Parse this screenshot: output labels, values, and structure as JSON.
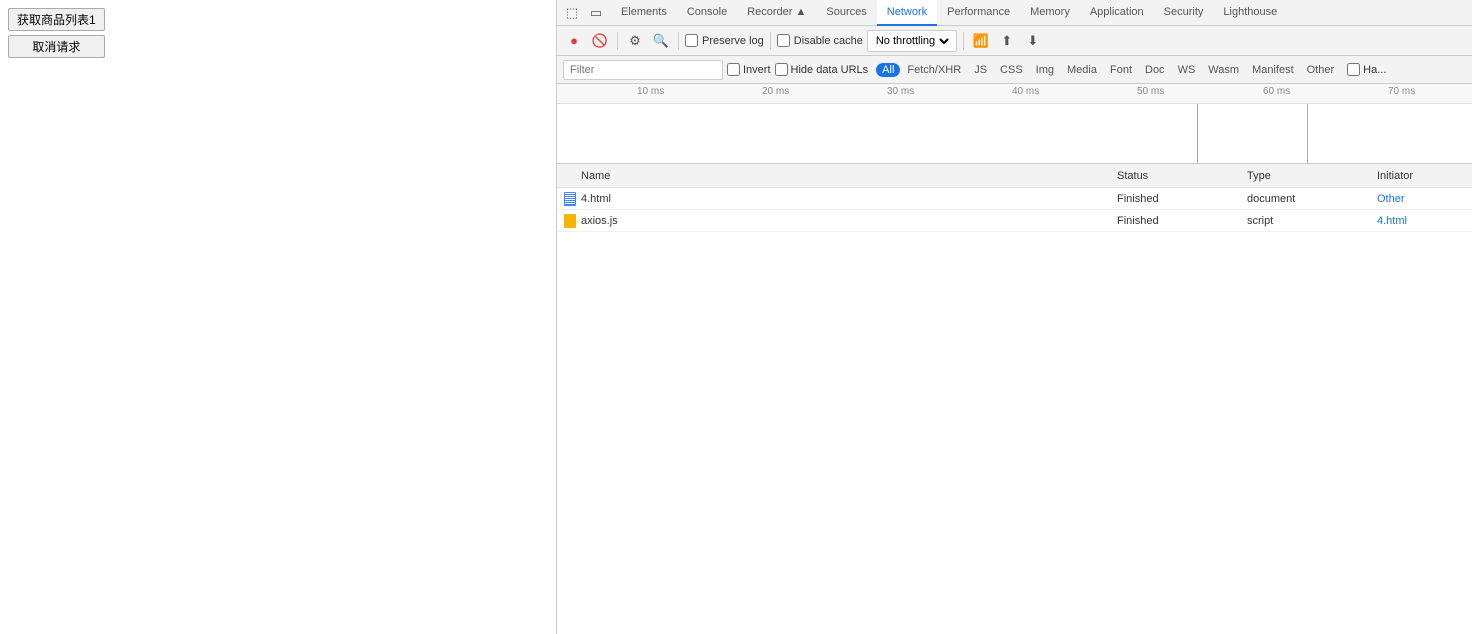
{
  "page": {
    "buttons": [
      {
        "label": "获取商品列表1",
        "type": "primary"
      },
      {
        "label": "取消请求",
        "type": "default"
      }
    ]
  },
  "devtools": {
    "tabs": [
      {
        "label": "Elements",
        "active": false
      },
      {
        "label": "Console",
        "active": false
      },
      {
        "label": "Recorder ▲",
        "active": false
      },
      {
        "label": "Sources",
        "active": false
      },
      {
        "label": "Network",
        "active": true
      },
      {
        "label": "Performance",
        "active": false
      },
      {
        "label": "Memory",
        "active": false
      },
      {
        "label": "Application",
        "active": false
      },
      {
        "label": "Security",
        "active": false
      },
      {
        "label": "Lighthouse",
        "active": false
      }
    ],
    "toolbar": {
      "preserve_log_label": "Preserve log",
      "disable_cache_label": "Disable cache",
      "throttle_label": "No throttling"
    },
    "filter": {
      "placeholder": "Filter",
      "invert_label": "Invert",
      "hide_data_urls_label": "Hide data URLs",
      "type_buttons": [
        "All",
        "Fetch/XHR",
        "JS",
        "CSS",
        "Img",
        "Media",
        "Font",
        "Doc",
        "WS",
        "Wasm",
        "Manifest",
        "Other",
        "Ha..."
      ]
    },
    "timeline": {
      "marks": [
        {
          "label": "10 ms",
          "position": 100
        },
        {
          "label": "20 ms",
          "position": 225
        },
        {
          "label": "30 ms",
          "position": 350
        },
        {
          "label": "40 ms",
          "position": 475
        },
        {
          "label": "50 ms",
          "position": 600
        },
        {
          "label": "60 ms",
          "position": 725
        },
        {
          "label": "70 ms",
          "position": 850
        }
      ]
    },
    "table": {
      "headers": [
        "Name",
        "Status",
        "Type",
        "Initiator"
      ],
      "rows": [
        {
          "name": "4.html",
          "icon_type": "doc",
          "status": "Finished",
          "type": "document",
          "initiator": "Other",
          "initiator_link": false
        },
        {
          "name": "axios.js",
          "icon_type": "js",
          "status": "Finished",
          "type": "script",
          "initiator": "4.html",
          "initiator_link": true
        }
      ]
    }
  }
}
